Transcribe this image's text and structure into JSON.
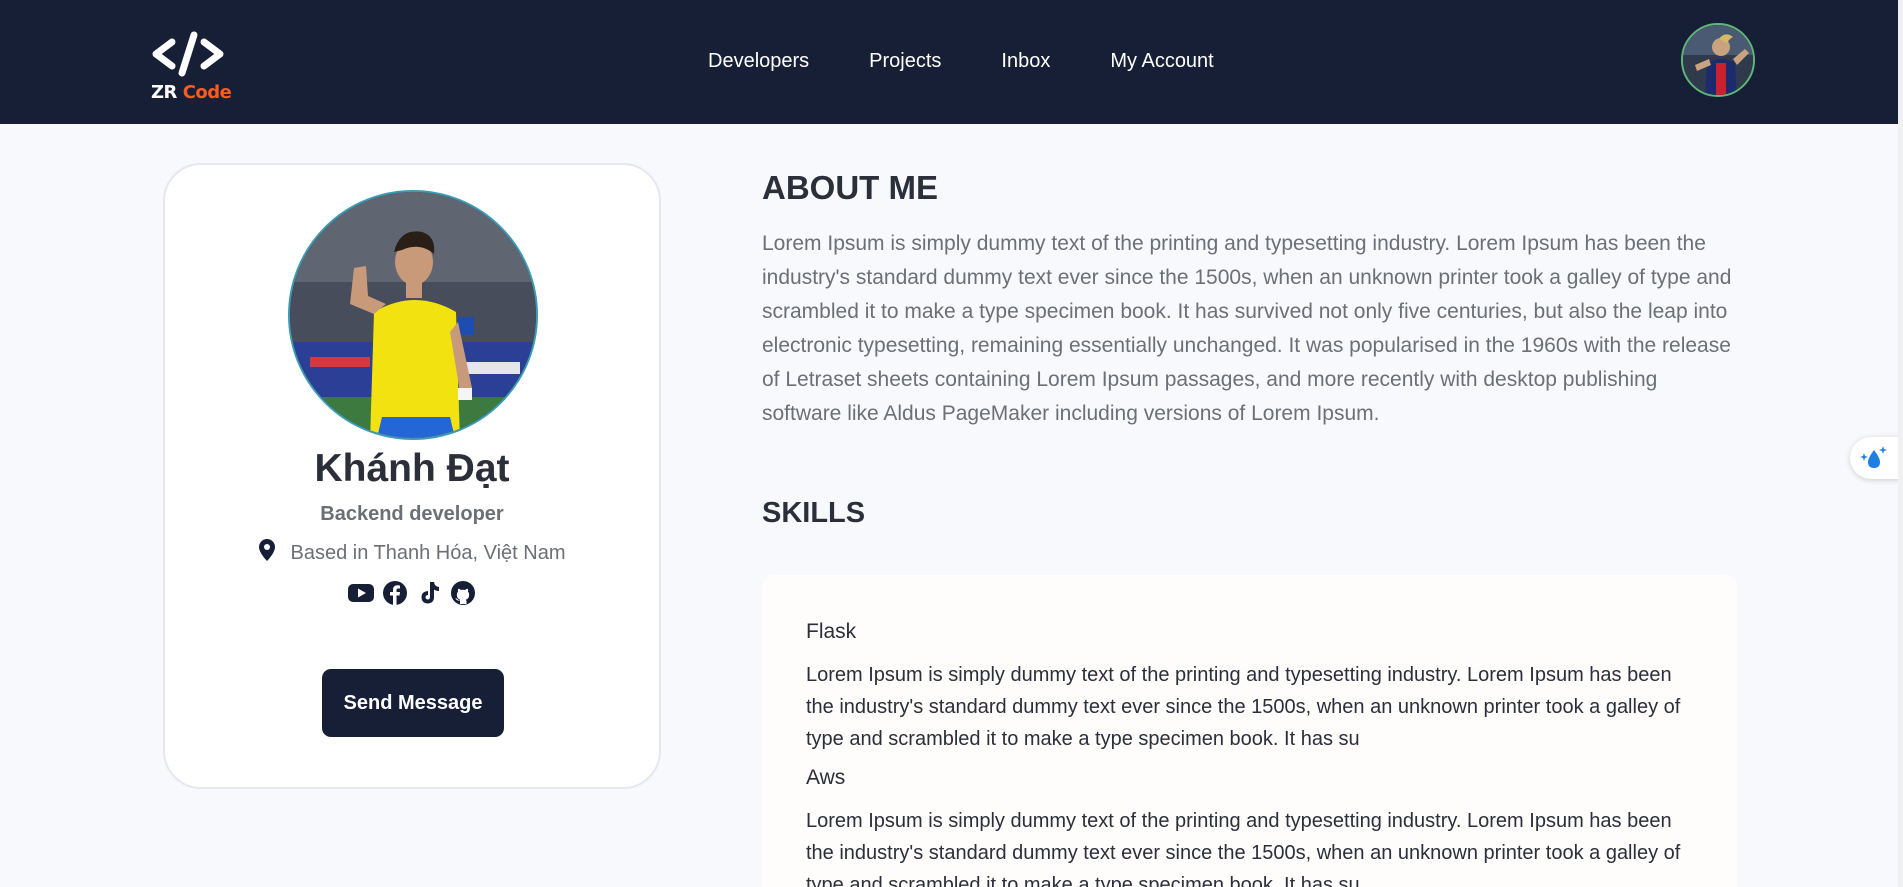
{
  "navbar": {
    "logo": {
      "line1": "ZR",
      "line2": "Code"
    },
    "links": [
      "Developers",
      "Projects",
      "Inbox",
      "My Account"
    ]
  },
  "profile": {
    "name": "Khánh Đạt",
    "role": "Backend developer",
    "location": "Based in Thanh Hóa, Việt Nam",
    "socials": [
      "youtube-icon",
      "facebook-icon",
      "tiktok-icon",
      "github-icon"
    ],
    "send_button": "Send Message"
  },
  "about": {
    "title": "ABOUT ME",
    "text": "Lorem Ipsum is simply dummy text of the printing and typesetting industry. Lorem Ipsum has been the industry's standard dummy text ever since the 1500s, when an unknown printer took a galley of type and scrambled it to make a type specimen book. It has survived not only five centuries, but also the leap into electronic typesetting, remaining essentially unchanged. It was popularised in the 1960s with the release of Letraset sheets containing Lorem Ipsum passages, and more recently with desktop publishing software like Aldus PageMaker including versions of Lorem Ipsum."
  },
  "skills": {
    "title": "SKILLS",
    "items": [
      {
        "name": "Flask",
        "desc": "Lorem Ipsum is simply dummy text of the printing and typesetting industry. Lorem Ipsum has been the industry's standard dummy text ever since the 1500s, when an unknown printer took a galley of type and scrambled it to make a type specimen book. It has su"
      },
      {
        "name": "Aws",
        "desc": "Lorem Ipsum is simply dummy text of the printing and typesetting industry. Lorem Ipsum has been the industry's standard dummy text ever since the 1500s, when an unknown printer took a galley of type and scrambled it to make a type specimen book. It has su"
      }
    ]
  },
  "colors": {
    "navbar_bg": "#161f36",
    "page_bg": "#f8f9fd",
    "brand_orange": "#ff5a1f",
    "text_dark": "#2b2f3a",
    "text_muted": "#6c6f76"
  }
}
